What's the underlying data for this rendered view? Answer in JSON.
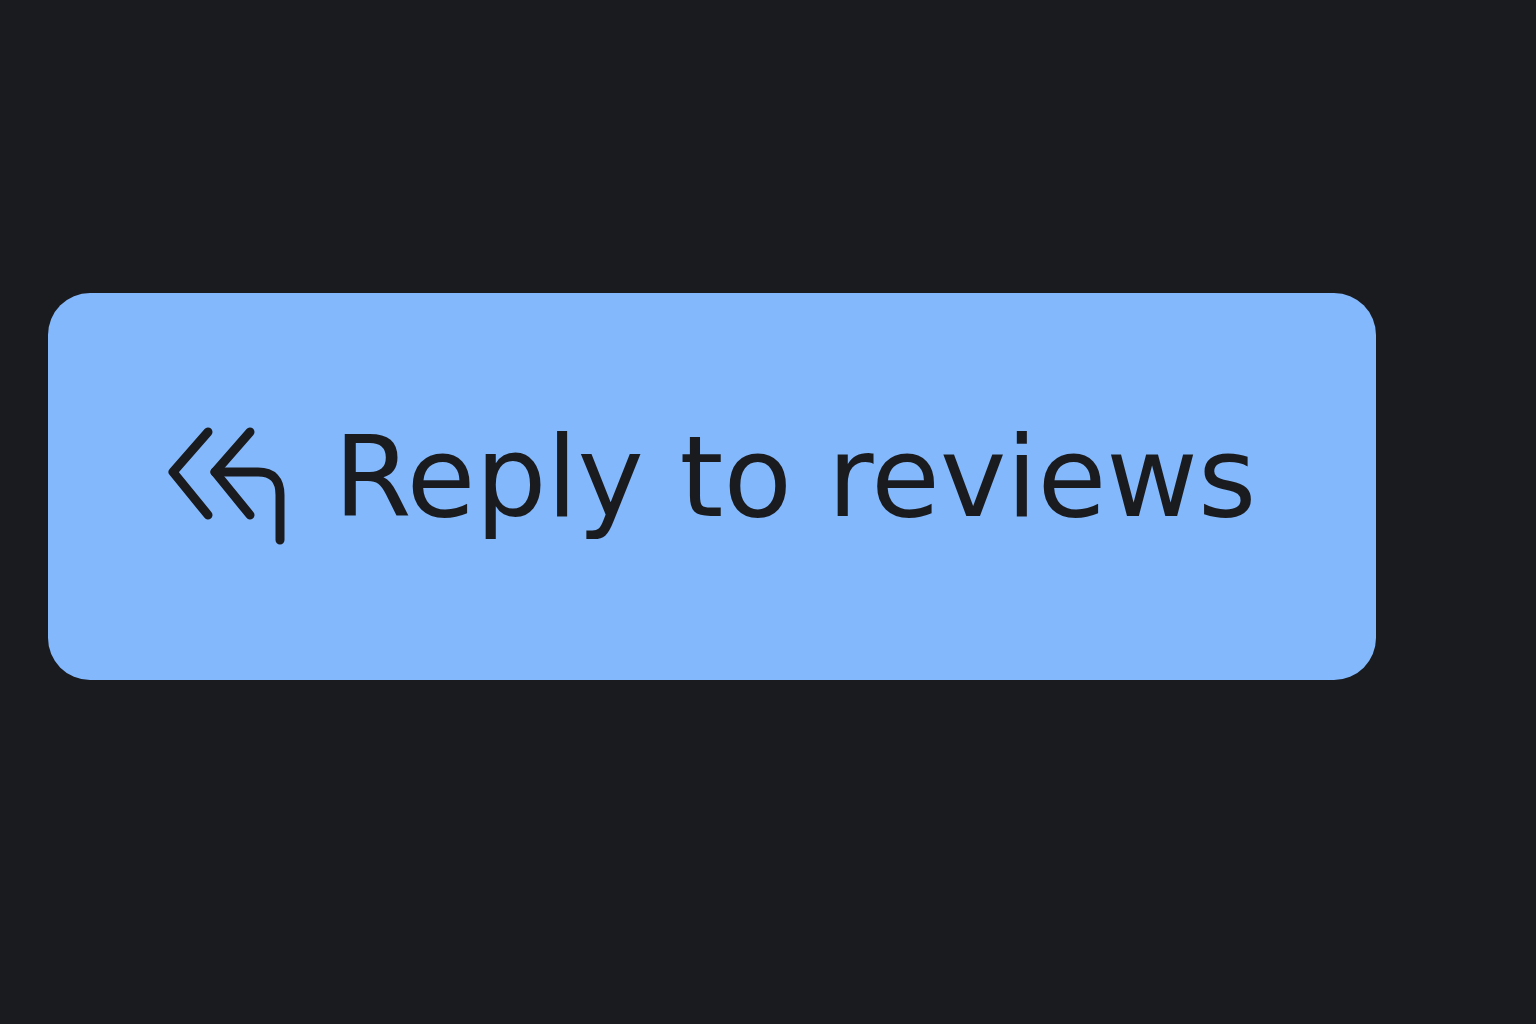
{
  "button": {
    "label": "Reply to reviews"
  }
}
